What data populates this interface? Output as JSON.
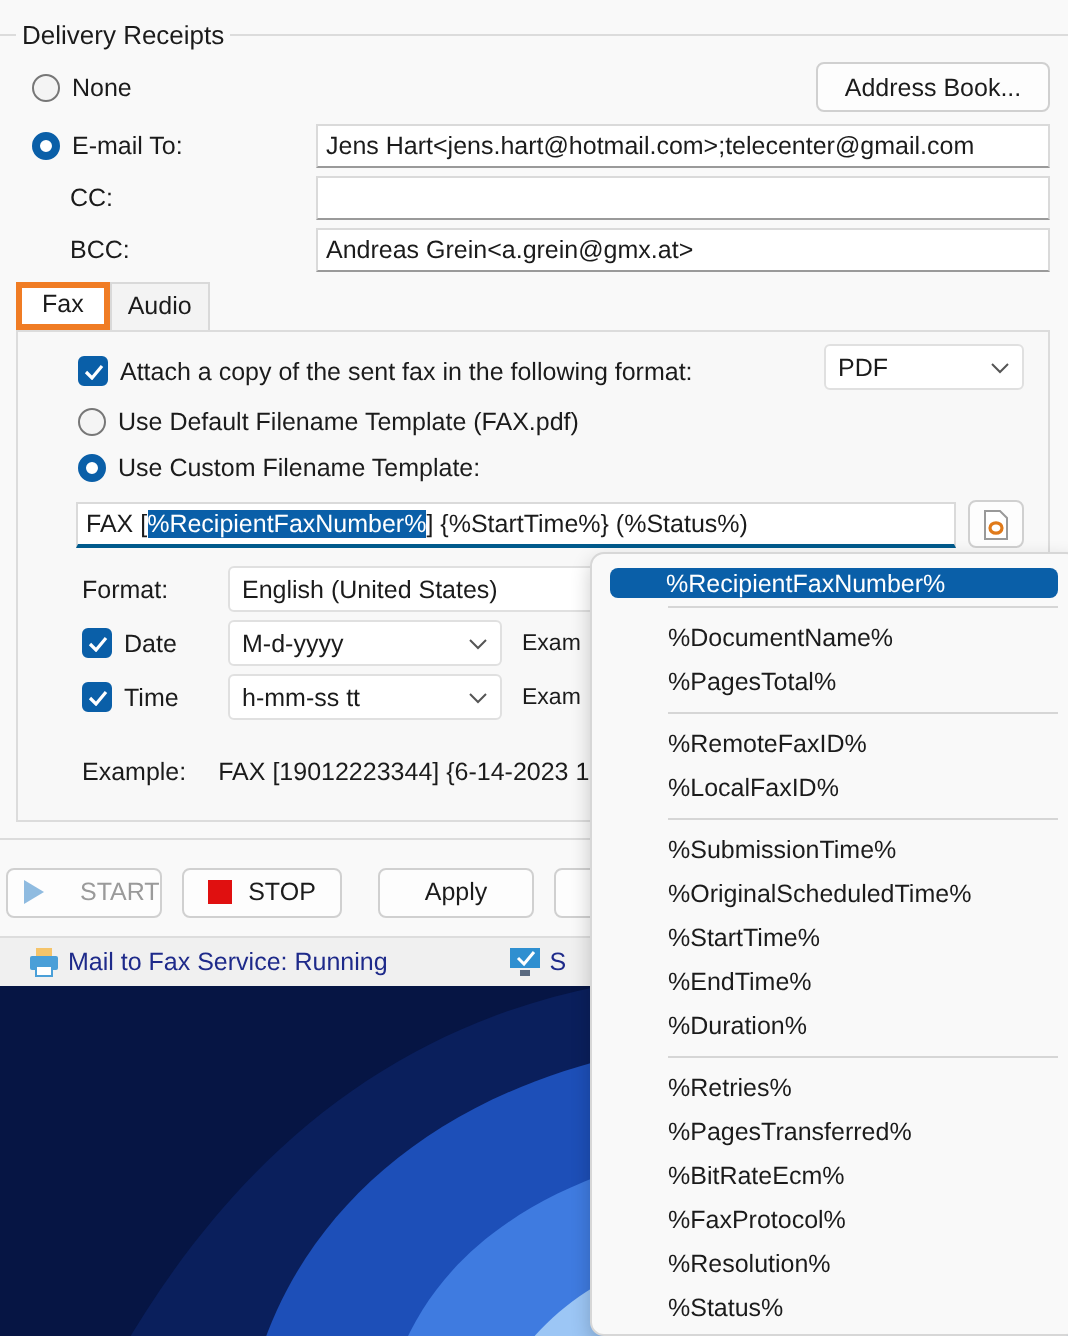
{
  "group_title": "Delivery Receipts",
  "address_book_button": "Address Book...",
  "none_option": {
    "label": "None",
    "selected": false
  },
  "email_option": {
    "label": "E-mail To:",
    "selected": true,
    "value": "Jens Hart<jens.hart@hotmail.com>;telecenter@gmail.com"
  },
  "cc": {
    "label": "CC:"
  },
  "bcc": {
    "label": "BCC:",
    "value": "Andreas Grein<a.grein@gmx.at>"
  },
  "tabs": [
    {
      "label": "Fax",
      "selected": true
    },
    {
      "label": "Audio",
      "selected": false
    }
  ],
  "attach": {
    "label": "Attach a copy of the sent fax in the following format:",
    "checked": true,
    "format": "PDF"
  },
  "filename_options": [
    {
      "label": "Use Default Filename Template (FAX.pdf)",
      "selected": false
    },
    {
      "label": "Use Custom Filename Template:",
      "selected": true
    }
  ],
  "template": {
    "before": "FAX [",
    "selection": "%RecipientFaxNumber%",
    "after": "] {%StartTime%} (%Status%)"
  },
  "format": {
    "label": "Format:",
    "value": "English (United States)"
  },
  "date": {
    "label": "Date",
    "checked": true,
    "value": "M-d-yyyy",
    "example": "Exam"
  },
  "time": {
    "label": "Time",
    "checked": true,
    "value": "h-mm-ss tt",
    "example": "Exam"
  },
  "example": {
    "label": "Example:",
    "value": "FAX [19012223344] {6-14-2023 1"
  },
  "toolbar": [
    {
      "label": "START",
      "kind": "start",
      "disabled": true
    },
    {
      "label": "STOP",
      "kind": "stop",
      "disabled": false
    },
    {
      "label": "Apply",
      "kind": "plain",
      "disabled": false
    }
  ],
  "status_bar": [
    {
      "text": "Mail to Fax Service: Running",
      "kind": "fax"
    },
    {
      "text": "S",
      "kind": "monitor"
    }
  ],
  "menu": {
    "groups": [
      [
        {
          "label": "%RecipientFaxNumber%",
          "selected": true
        }
      ],
      [
        {
          "label": "%DocumentName%",
          "selected": false
        },
        {
          "label": "%PagesTotal%",
          "selected": false
        }
      ],
      [
        {
          "label": "%RemoteFaxID%",
          "selected": false
        },
        {
          "label": "%LocalFaxID%",
          "selected": false
        }
      ],
      [
        {
          "label": "%SubmissionTime%",
          "selected": false
        },
        {
          "label": "%OriginalScheduledTime%",
          "selected": false
        },
        {
          "label": "%StartTime%",
          "selected": false
        },
        {
          "label": "%EndTime%",
          "selected": false
        },
        {
          "label": "%Duration%",
          "selected": false
        }
      ],
      [
        {
          "label": "%Retries%",
          "selected": false
        },
        {
          "label": "%PagesTransferred%",
          "selected": false
        },
        {
          "label": "%BitRateEcm%",
          "selected": false
        },
        {
          "label": "%FaxProtocol%",
          "selected": false
        },
        {
          "label": "%Resolution%",
          "selected": false
        },
        {
          "label": "%Status%",
          "selected": false
        }
      ]
    ]
  }
}
